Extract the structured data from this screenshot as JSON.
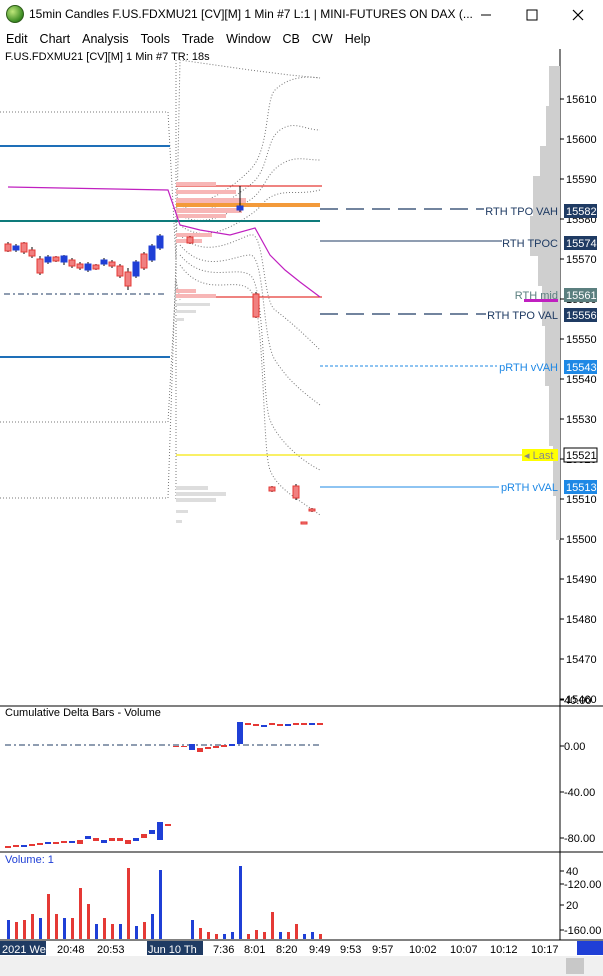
{
  "window": {
    "title": "15min Candles F.US.FDXMU21 [CV][M]  1 Min   #7 L:1 | MINI-FUTURES ON DAX (...",
    "minimize_icon": "minimize-icon",
    "maximize_icon": "maximize-icon",
    "close_icon": "close-icon"
  },
  "menu": [
    "Edit",
    "Chart",
    "Analysis",
    "Tools",
    "Trade",
    "Window",
    "CB",
    "CW",
    "Help"
  ],
  "chart": {
    "symbol_label": "F.US.FDXMU21 [CV][M]  1 Min   #7 TR: 18s",
    "price_ticks": [
      "15610",
      "15600",
      "15590",
      "15580",
      "15570",
      "15560",
      "15550",
      "15540",
      "15530",
      "15520",
      "15510",
      "15500",
      "15490",
      "15480",
      "15470",
      "15460"
    ],
    "level_tags": [
      {
        "label": "RTH TPO VAH",
        "value": "15582",
        "color": "#1f3b63"
      },
      {
        "label": "RTH TPOC",
        "value": "15574",
        "color": "#1f3b63"
      },
      {
        "label": "RTH mid",
        "value": "15561",
        "color": "#5b7f7f"
      },
      {
        "label": "RTH TPO VAL",
        "value": "15556",
        "color": "#1f3b63"
      },
      {
        "label": "pRTH vVAH",
        "value": "15543",
        "color": "#1e88e5"
      },
      {
        "label": "Last",
        "value": "15521",
        "color": "#ffff00"
      },
      {
        "label": "pRTH vVAL",
        "value": "15513",
        "color": "#1e88e5"
      }
    ]
  },
  "delta_pane": {
    "title": "Cumulative Delta Bars - Volume",
    "ticks": [
      "40.00",
      "0.00",
      "-40.00",
      "-80.00",
      "-120.00",
      "-160.00"
    ]
  },
  "volume_pane": {
    "title": "Volume: 1",
    "ticks": [
      "40",
      "20"
    ]
  },
  "time_axis": {
    "labels": [
      "2021 We",
      "20:48",
      "20:53",
      "Jun 10  Th",
      "7:36",
      "8:01",
      "8:20",
      "9:49",
      "9:53",
      "9:57",
      "10:02",
      "10:07",
      "10:12",
      "10:17"
    ]
  },
  "colors": {
    "up": "#1f3fd6",
    "down": "#e53935",
    "vwap": "#c020c0",
    "level_blue": "#1e6fb8",
    "level_teal": "#0e7b7b"
  }
}
